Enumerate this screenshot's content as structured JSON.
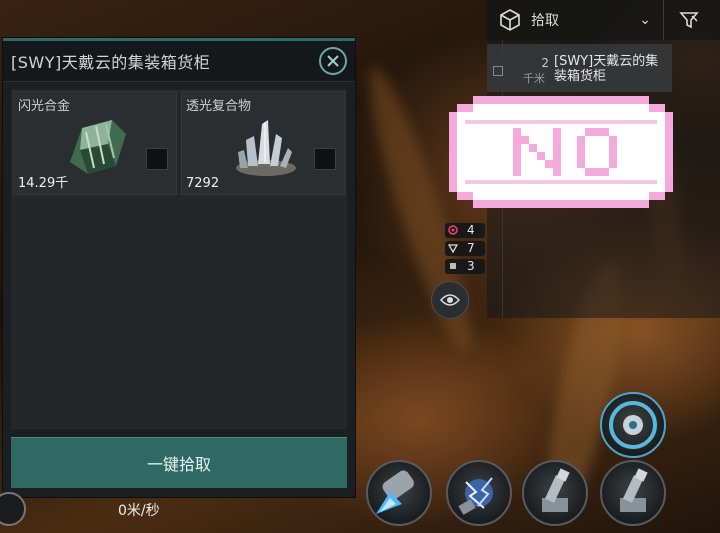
{
  "cargo_window": {
    "title": "[SWY]天戴云的集装箱货柜",
    "items": [
      {
        "name": "闪光合金",
        "quantity": "14.29千"
      },
      {
        "name": "透光复合物",
        "quantity": "7292"
      }
    ],
    "pickup_all_label": "一键拾取"
  },
  "top_bar": {
    "action_label": "拾取"
  },
  "overview": {
    "row": {
      "distance_value": "2",
      "distance_unit": "千米",
      "name": "[SWY]天戴云的集装箱货柜"
    }
  },
  "sticker_text": "NO",
  "counters": [
    {
      "icon": "target-icon",
      "value": "4"
    },
    {
      "icon": "drone-icon",
      "value": "7"
    },
    {
      "icon": "square-icon",
      "value": "3"
    }
  ],
  "ship": {
    "speed": "0米/秒"
  },
  "modules": [
    "shield-booster-module",
    "ecm-burst-module",
    "mining-laser-module-1",
    "mining-laser-module-2",
    "afterburner-module"
  ],
  "colors": {
    "accent_teal": "#2e6a63",
    "sticker_pink": "#f5a9dd"
  }
}
